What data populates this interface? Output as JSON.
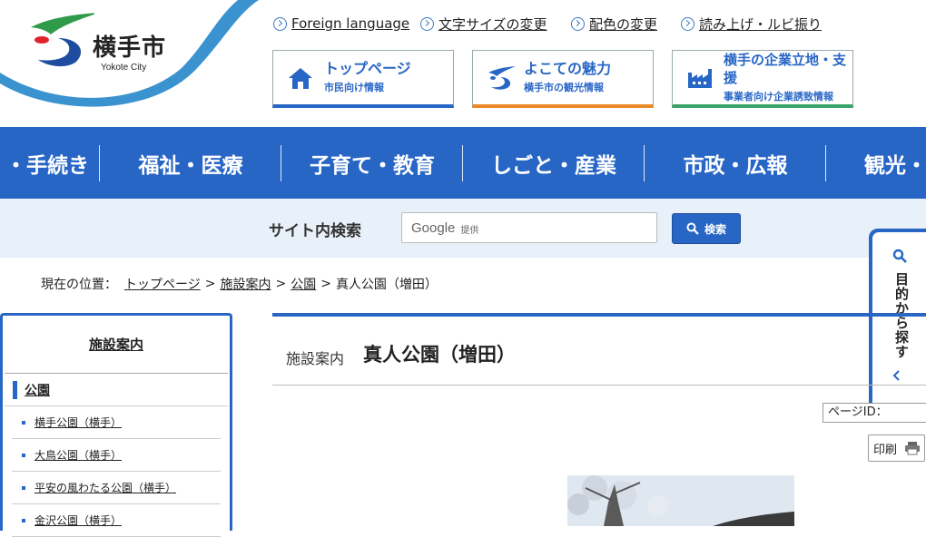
{
  "header": {
    "city_name": "横手市",
    "city_name_en": "Yokote City",
    "util_links": [
      {
        "label": "Foreign language"
      },
      {
        "label": "文字サイズの変更"
      },
      {
        "label": "配色の変更"
      },
      {
        "label": "読み上げ・ルビ振り"
      }
    ],
    "big_buttons": [
      {
        "title": "トップページ",
        "sub": "市民向け情報",
        "icon": "house-icon",
        "color": "#2866c6"
      },
      {
        "title": "よこての魅力",
        "sub": "横手市の観光情報",
        "icon": "city-logo-icon",
        "color": "#e98a2b"
      },
      {
        "title": "横手の企業立地・支援",
        "sub": "事業者向け企業誘致情報",
        "icon": "factory-icon",
        "color": "#3aa36a"
      }
    ]
  },
  "global_nav": [
    "・手続き",
    "福祉・医療",
    "子育て・教育",
    "しごと・産業",
    "市政・広報",
    "観光・"
  ],
  "search": {
    "label": "サイト内検索",
    "google": "Google",
    "provided": "提供",
    "button": "検索"
  },
  "side_tab": {
    "label": "目的から探す"
  },
  "breadcrumb": {
    "prefix": "現在の位置：",
    "items": [
      "トップページ",
      "施設案内",
      "公園"
    ],
    "current": "真人公園（増田）"
  },
  "left_nav": {
    "title": "施設案内",
    "category": "公園",
    "items": [
      "横手公園（横手）",
      "大鳥公園（横手）",
      "平安の風わたる公園（横手）",
      "金沢公園（横手）"
    ]
  },
  "main": {
    "category_label": "施設案内",
    "title": "真人公園（増田）",
    "page_id": "ページID：",
    "print": "印刷"
  },
  "colors": {
    "primary": "#2866c6",
    "search_bg": "#e8f0f9"
  }
}
